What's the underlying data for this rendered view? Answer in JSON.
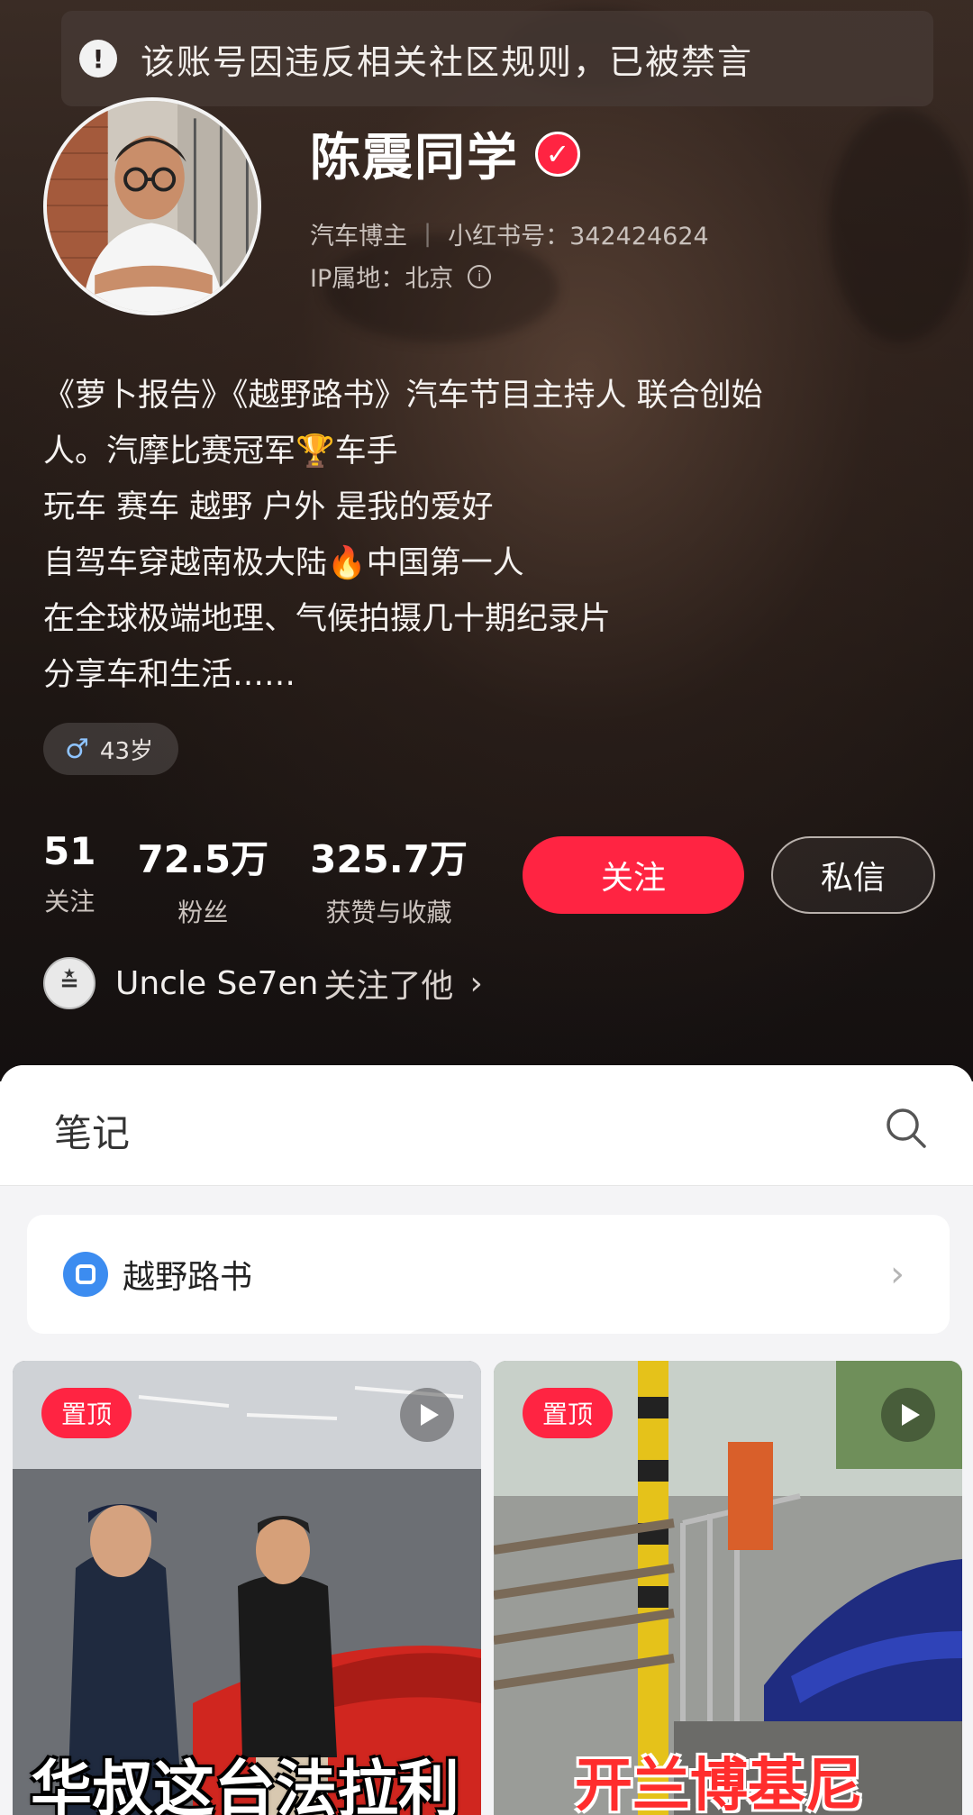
{
  "banner": {
    "text": "该账号因违反相关社区规则，已被禁言",
    "icon": "alert-icon"
  },
  "profile": {
    "nickname": "陈震同学",
    "category": "汽车博主",
    "divider": "|",
    "red_id_label": "小红书号：342424624",
    "ip_label": "IP属地：北京",
    "bio_lines": [
      "《萝卜报告》《越野路书》汽车节目主持人 联合创始",
      "人。汽摩比赛冠军🏆车手",
      "玩车 赛车 越野 户外 是我的爱好",
      "自驾车穿越南极大陆🔥中国第一人",
      "在全球极端地理、气候拍摄几十期纪录片",
      "分享车和生活……"
    ],
    "age_tag": "43岁",
    "gender_icon": "♂"
  },
  "stats": [
    {
      "value": "51",
      "label": "关注"
    },
    {
      "value": "72.5万",
      "label": "粉丝"
    },
    {
      "value": "325.7万",
      "label": "获赞与收藏"
    }
  ],
  "actions": {
    "follow": "关注",
    "message": "私信"
  },
  "followed_by": {
    "name": "Uncle Se7en",
    "text": "关注了他",
    "chevron": "›"
  },
  "tabs": {
    "notes": "笔记"
  },
  "collection": {
    "label": "越野路书",
    "chevron": "›"
  },
  "cards": [
    {
      "badge": "置顶",
      "caption": "华叔这台法拉利"
    },
    {
      "badge": "置顶",
      "caption": "开兰博基尼"
    }
  ],
  "colors": {
    "accent": "#ff2442",
    "header_bg": "#1d1613",
    "collection_icon": "#3c8cf0"
  }
}
